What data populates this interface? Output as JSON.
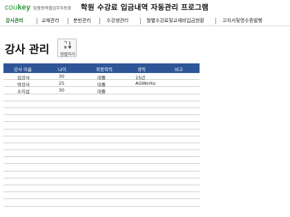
{
  "header": {
    "logo_text": "cou",
    "logo_key": "key",
    "logo_sub": "맞춤형엑셀업무자동화",
    "title": "학원 수강료 입금내역 자동관리 프로그램"
  },
  "nav": {
    "items": [
      {
        "label": "강사관리",
        "active": true
      },
      {
        "label": "교재관리",
        "active": false
      },
      {
        "label": "분반관리",
        "active": false
      },
      {
        "label": "수강생관리",
        "active": false
      },
      {
        "label": "월별수강료및교재비입금현황",
        "active": false
      },
      {
        "label": "고지서및영수증발행",
        "active": false
      }
    ]
  },
  "page": {
    "title": "강사 관리",
    "sort_button_icon": "ㄱ\nㅎ↓",
    "sort_button_label": "정렬하기"
  },
  "table": {
    "headers": [
      "강사 이름",
      "나이",
      "최종학력",
      "경력",
      "비고"
    ],
    "rows": [
      [
        "김강사",
        "30",
        "대졸",
        "15년",
        ""
      ],
      [
        "박강사",
        "25",
        "대졸",
        "AGWorks",
        ""
      ],
      [
        "소지섭",
        "30",
        "대졸",
        "",
        ""
      ]
    ]
  }
}
